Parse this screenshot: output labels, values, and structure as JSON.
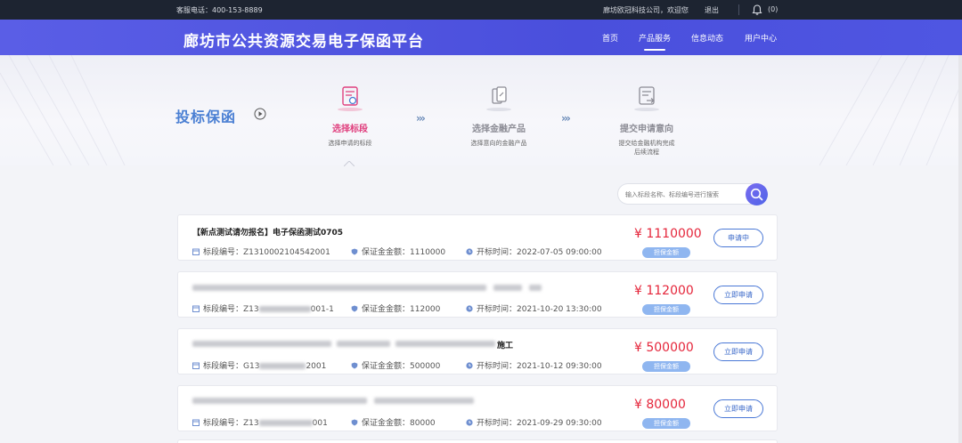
{
  "topbar": {
    "phone": "客服电话：400-153-8889",
    "welcome": "廊坊欧冠科技公司，欢迎您",
    "logout": "退出",
    "notif_count": "(0)"
  },
  "header": {
    "title": "廊坊市公共资源交易电子保函平台",
    "nav": [
      {
        "label": "首页"
      },
      {
        "label": "产品服务"
      },
      {
        "label": "信息动态"
      },
      {
        "label": "用户中心"
      }
    ]
  },
  "banner": {
    "section_title": "投标保函",
    "arrows": "›››",
    "steps": [
      {
        "name": "选择标段",
        "desc": "选择申请的标段",
        "color": "#e0417f"
      },
      {
        "name": "选择金融产品",
        "desc": "选择意向的金融产品",
        "color": "#8c8c95"
      },
      {
        "name": "提交申请意向",
        "desc": "提交给金融机构完成",
        "desc2": "后续流程",
        "color": "#8c8c95"
      }
    ]
  },
  "search": {
    "placeholder": "输入标段名称、标段编号进行搜索"
  },
  "list": {
    "code_label": "标段编号：",
    "margin_label": "保证金金额：",
    "open_label": "开标时间：",
    "badge": "担保金额",
    "items": [
      {
        "title": "【新点测试请勿报名】电子保函测试0705",
        "title_suffix": "",
        "code": "Z1310002104542001",
        "code_tail": "",
        "margin": "1110000",
        "open_time": "2022-07-05 09:00:00",
        "amount": "¥ 1110000",
        "action": "申请中"
      },
      {
        "title": "",
        "title_suffix": "",
        "code": "Z13",
        "code_tail": "001-1",
        "margin": "112000",
        "open_time": "2021-10-20 13:30:00",
        "amount": "¥ 112000",
        "action": "立即申请"
      },
      {
        "title": "",
        "title_suffix": "施工",
        "code": "G13",
        "code_tail": "2001",
        "margin": "500000",
        "open_time": "2021-10-12 09:30:00",
        "amount": "¥ 500000",
        "action": "立即申请"
      },
      {
        "title": "",
        "title_suffix": "",
        "code": "Z13",
        "code_tail": "001",
        "margin": "80000",
        "open_time": "2021-09-29 09:30:00",
        "amount": "¥ 80000",
        "action": "立即申请"
      }
    ]
  },
  "colors": {
    "header": "#4a4fdc",
    "amount": "#e5263b",
    "accent_blue": "#4a78d6"
  }
}
